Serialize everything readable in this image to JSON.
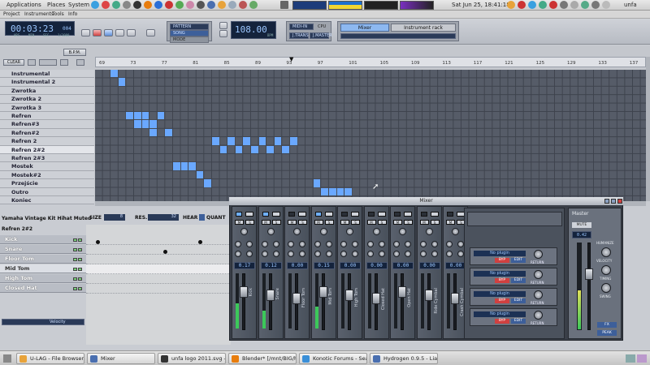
{
  "system": {
    "menus": [
      "Applications",
      "Places",
      "System"
    ],
    "clock": "Sat Jun 25, 18:41:18",
    "user": "unfa"
  },
  "hydrogen_menu": [
    "Project",
    "Instruments",
    "Tools",
    "Info"
  ],
  "transport": {
    "time": "00:03:23",
    "time_ms": "004",
    "time_units": [
      "HRS",
      "MIN",
      "SEC",
      "1/1000"
    ],
    "mode_labels": [
      "PATTERN",
      "SONG",
      "MODE"
    ],
    "bpm": "108.00",
    "bpm_label": "BPM",
    "midi_in": "MIDI-IN",
    "cpu": "CPU",
    "trans": "J.TRANS",
    "jmaster": "J.MASTER",
    "tabs": [
      "Mixer",
      "Instrument rack"
    ]
  },
  "song_editor": {
    "bpm_btn": "B.P.M.",
    "clear_btn": "CLEAR",
    "ruler": [
      "69",
      "73",
      "77",
      "81",
      "85",
      "89",
      "93",
      "97",
      "101",
      "105",
      "109",
      "113",
      "117",
      "121",
      "125",
      "129",
      "133",
      "137"
    ],
    "patterns": [
      "Instrumental",
      "Instrumental 2",
      "Zwrotka",
      "Zwrotka 2",
      "Zwrotka 3",
      "Refren",
      "Refren#3",
      "Refren#2",
      "Refren 2",
      "Refren 2#2",
      "Refren 2#3",
      "Mostek",
      "Mostek#2",
      "Przejście",
      "Outro",
      "Koniec"
    ],
    "selected_pattern": "Refren 2#2",
    "cells": [
      [
        2,
        0
      ],
      [
        3,
        1
      ],
      [
        4,
        5
      ],
      [
        5,
        6
      ],
      [
        6,
        5
      ],
      [
        7,
        6
      ],
      [
        8,
        5
      ],
      [
        9,
        7
      ],
      [
        5,
        5
      ],
      [
        6,
        6
      ],
      [
        7,
        7
      ],
      [
        15,
        8
      ],
      [
        16,
        9
      ],
      [
        17,
        8
      ],
      [
        18,
        9
      ],
      [
        19,
        8
      ],
      [
        20,
        9
      ],
      [
        21,
        8
      ],
      [
        22,
        9
      ],
      [
        23,
        8
      ],
      [
        24,
        9
      ],
      [
        25,
        8
      ],
      [
        10,
        11
      ],
      [
        11,
        11
      ],
      [
        12,
        11
      ],
      [
        13,
        12
      ],
      [
        14,
        13
      ],
      [
        28,
        13
      ],
      [
        29,
        14
      ],
      [
        30,
        14
      ],
      [
        31,
        14
      ],
      [
        32,
        14
      ]
    ]
  },
  "pattern_editor": {
    "drumkit": "Yamaha Vintage Kit Hihat Muted",
    "pattern_name": "Refren 2#2",
    "size_label": "SIZE",
    "size_value": "8",
    "res_label": "RES.",
    "res_value": "32",
    "hear_label": "HEAR",
    "quant_label": "QUANT",
    "ruler_marks": [
      "1",
      "2"
    ],
    "instruments": [
      "Kick",
      "Snare",
      "Floor Tom",
      "Mid Tom",
      "High Tom",
      "Closed Hat"
    ],
    "selected_instrument": "Mid Tom",
    "velocity_label": "Velocity"
  },
  "mixer": {
    "title": "Mixer",
    "channels": [
      {
        "name": "Kick",
        "peak": "0.17",
        "active": true
      },
      {
        "name": "Snare",
        "peak": "0.12",
        "active": true
      },
      {
        "name": "Floor Tom",
        "peak": "0.00",
        "active": false
      },
      {
        "name": "Mid Tom",
        "peak": "0.15",
        "active": true
      },
      {
        "name": "High Tom",
        "peak": "0.00",
        "active": false
      },
      {
        "name": "Closed Hat",
        "peak": "0.00",
        "active": false
      },
      {
        "name": "Open Hat",
        "peak": "0.00",
        "active": false
      },
      {
        "name": "Ride Cymbal",
        "peak": "0.00",
        "active": false
      },
      {
        "name": "Crash Cymbal",
        "peak": "0.00",
        "active": false
      }
    ],
    "fx_slots": [
      {
        "name": "No plugin",
        "byp": "BYP",
        "edit": "EDIT",
        "ret": "RETURN"
      },
      {
        "name": "No plugin",
        "byp": "BYP",
        "edit": "EDIT",
        "ret": "RETURN"
      },
      {
        "name": "No plugin",
        "byp": "BYP",
        "edit": "EDIT",
        "ret": "RETURN"
      },
      {
        "name": "No plugin",
        "byp": "BYP",
        "edit": "EDIT",
        "ret": "RETURN"
      }
    ],
    "master": {
      "label": "Master",
      "mute": "MUTE",
      "peak": "0.42",
      "humanize": "HUMANIZE",
      "velocity": "VELOCITY",
      "timing": "TIMING",
      "swing": "SWING",
      "fx_btn": "FX",
      "peak_btn": "PEAK"
    }
  },
  "taskbar": [
    {
      "label": "U-LAG - File Browser",
      "color": "#e8a33a"
    },
    {
      "label": "Mixer",
      "color": "#4a6fb0"
    },
    {
      "label": "unfa logo 2011.svg - I...",
      "color": "#333333"
    },
    {
      "label": "Blender* [/mnt/BIG/h...",
      "color": "#e87d0d"
    },
    {
      "label": "Konotic Forums - Sea...",
      "color": "#3a8fd8"
    },
    {
      "label": "Hydrogen 0.9.5 - Liar...",
      "color": "#4a6fb0"
    }
  ]
}
